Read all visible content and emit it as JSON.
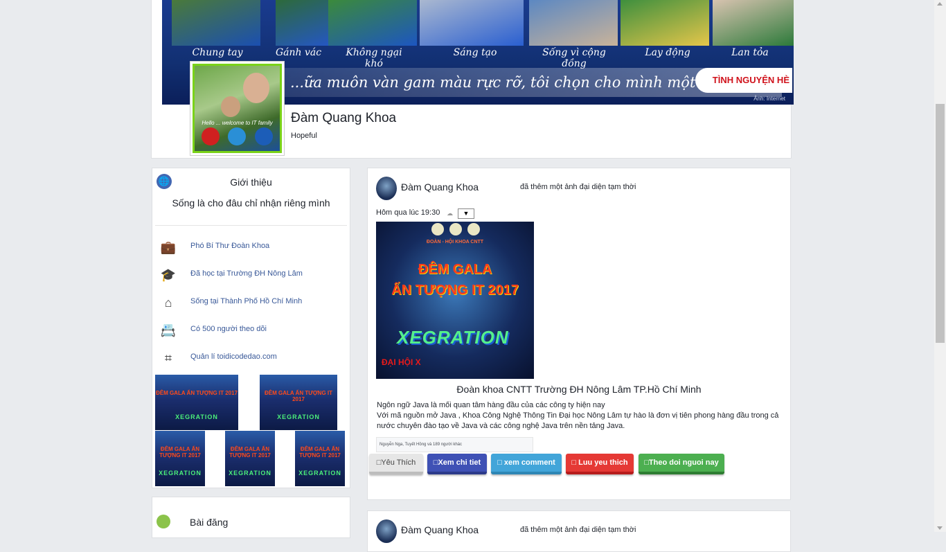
{
  "cover": {
    "captions": [
      "Chung tay",
      "Gánh vác",
      "Không ngại khó",
      "Sáng tạo",
      "Sống vì cộng đồng",
      "Lay động",
      "Lan tỏa"
    ],
    "slogan": "...ữa muôn vàn gam màu rực rỡ, tôi chọn cho mình một sắc thanh xuân",
    "logo_text": "TÌNH NGUYỆN HÈ",
    "credit": "Ảnh: Internet"
  },
  "profile": {
    "name": "Đàm Quang Khoa",
    "subtitle": "Hopeful",
    "avatar_text": "Hello ... welcome to IT family"
  },
  "intro": {
    "title": "Giới thiệu",
    "motto": "Sống là cho đâu chỉ nhận riêng mình",
    "items": [
      {
        "icon": "briefcase-icon",
        "label": "Phó Bí Thư Đoàn Khoa"
      },
      {
        "icon": "graduation-cap-icon",
        "label": "Đã học tại Trường ĐH Nông Lâm"
      },
      {
        "icon": "home-icon",
        "label": "Sống tại Thành Phố Hồ Chí Minh"
      },
      {
        "icon": "id-card-icon",
        "label": "Có 500 người theo dõi"
      },
      {
        "icon": "signpost-icon",
        "label": "Quản lí toidicodedao.com"
      }
    ],
    "thumb_line1": "ĐÊM GALA ẤN TƯỢNG IT 2017",
    "thumb_line2": "XEGRATION"
  },
  "posts_section": {
    "title": "Bài đăng"
  },
  "post": {
    "author": "Đàm Quang Khoa",
    "action": "đã thêm một ảnh đại diện tạm thời",
    "time": "Hôm qua lúc 19:30",
    "privacy_dropdown": "▼",
    "poster": {
      "subtitle": "ĐOÀN - HỘI KHOA CNTT",
      "line1": "ĐÊM GALA",
      "line2": "ẤN TƯỢNG IT 2017",
      "brand": "XEGRATION",
      "footer": "ĐẠI HỘI X"
    },
    "caption": "Đoàn khoa CNTT Trường ĐH Nông Lâm TP.Hồ Chí Minh",
    "body_line1": "Ngôn ngữ Java là mối quan tâm hàng đầu của các công ty hiện nay",
    "body_line2": "Với mã nguồn mở Java , Khoa Công Nghệ Thông Tin Đại học Nông Lâm tự hào là đơn vị tiên phong hàng đầu trong cả nước chuyên đào tạo về Java và các công nghệ Java trên nền tảng Java.",
    "likes": "Nguyễn Nga, Tuyết Hồng và 189 người khác",
    "buttons": {
      "like": "Yêu Thích",
      "detail": "Xem chi tiet",
      "comment": "xem comment",
      "save": "Luu yeu thich",
      "follow": "Theo doi nguoi nay"
    }
  },
  "post2": {
    "author": "Đàm Quang Khoa",
    "action": "đã thêm một ảnh đại diện tạm thời"
  },
  "colors": {
    "page_bg": "#e9ebee",
    "link": "#385898",
    "btn_blue": "#3f51b5",
    "btn_cyan": "#42a5d9",
    "btn_red": "#e53935",
    "btn_green": "#4caf50"
  }
}
